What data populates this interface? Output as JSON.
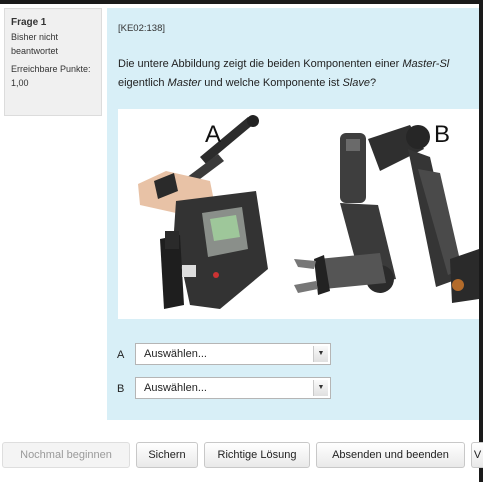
{
  "info": {
    "question_label": "Frage",
    "question_number": "1",
    "state": "Bisher nicht beantwortet",
    "points_label": "Erreichbare Punkte:",
    "points_value": "1,00"
  },
  "question": {
    "id": "[KE02:138]",
    "text_line1_a": "Die untere Abbildung zeigt die beiden Komponenten einer ",
    "text_line1_em": "Master-Sl",
    "text_line2_a": "eigentlich ",
    "text_line2_em1": "Master",
    "text_line2_b": " und welche Komponente ist ",
    "text_line2_em2": "Slave",
    "text_line2_c": "?",
    "figure_label_a": "A",
    "figure_label_b": "B"
  },
  "answers": [
    {
      "label": "A",
      "select_value": "Auswählen..."
    },
    {
      "label": "B",
      "select_value": "Auswählen..."
    }
  ],
  "buttons": {
    "restart": "Nochmal beginnen",
    "save": "Sichern",
    "correct": "Richtige Lösung",
    "submit": "Absenden und beenden",
    "next_partial": "V"
  }
}
